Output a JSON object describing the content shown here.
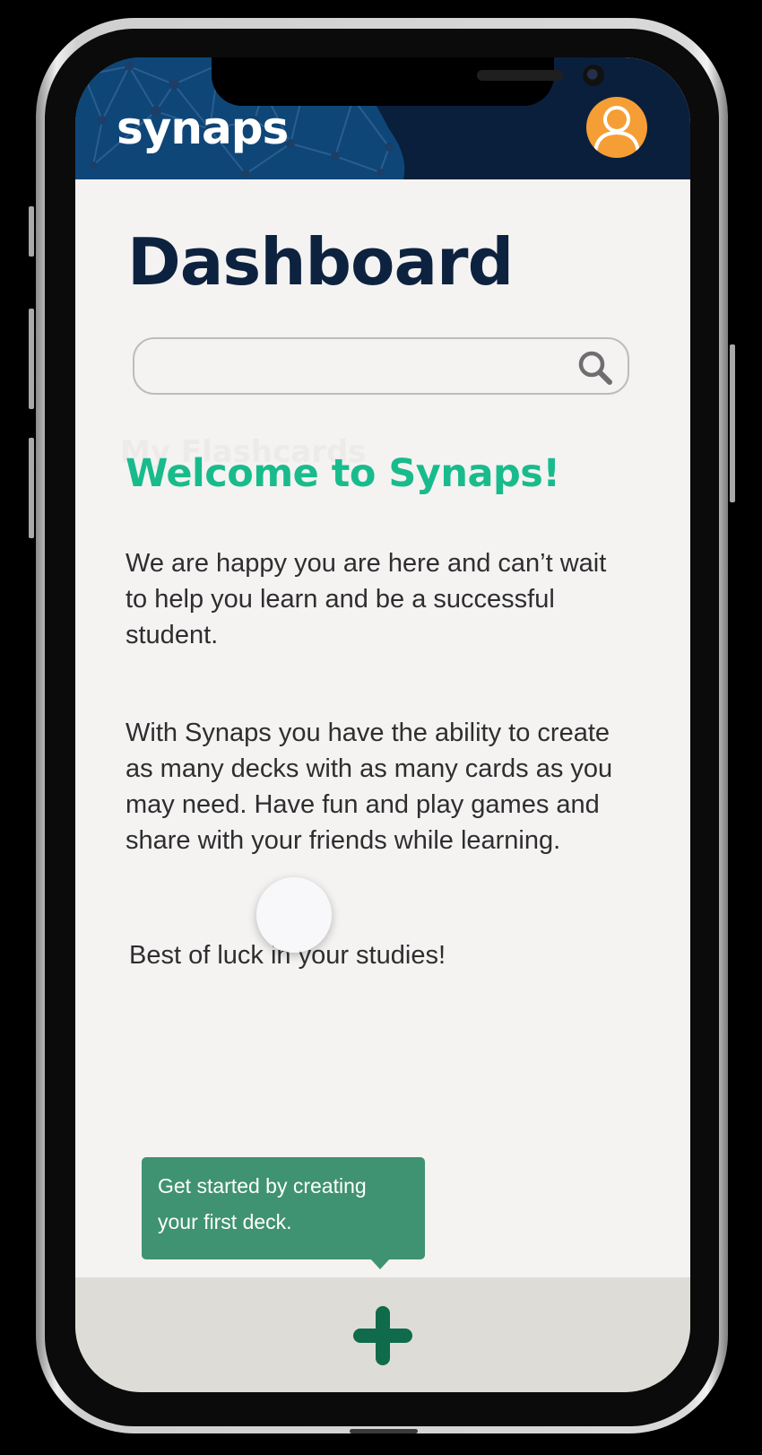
{
  "app": {
    "logo": "synaps",
    "profile_icon": "user-profile-icon"
  },
  "page": {
    "title": "Dashboard",
    "background_heading": "My Flashcards"
  },
  "search": {
    "value": "",
    "placeholder": "",
    "icon": "search-icon"
  },
  "welcome": {
    "heading": "Welcome to Synaps!",
    "paragraph_1": "We are happy you are here and can’t wait to help you learn and be a successful student.",
    "paragraph_2": "With Synaps you have the ability to create as many decks with as many cards as you may need. Have fun and play games and share with your friends while learning.",
    "paragraph_3": "Best of luck in your studies!"
  },
  "tooltip": {
    "text": "Get started by  creating your first deck."
  },
  "bottom_bar": {
    "add_icon": "plus-icon"
  },
  "colors": {
    "header_navy": "#0a1f3c",
    "title_navy": "#0d223f",
    "accent_green": "#19bb8c",
    "tooltip_green": "#3f9272",
    "plus_green": "#0f6b4c",
    "avatar_orange": "#f59e35",
    "screen_bg": "#f4f3f2",
    "bottom_bar_bg": "#dedcd6"
  }
}
